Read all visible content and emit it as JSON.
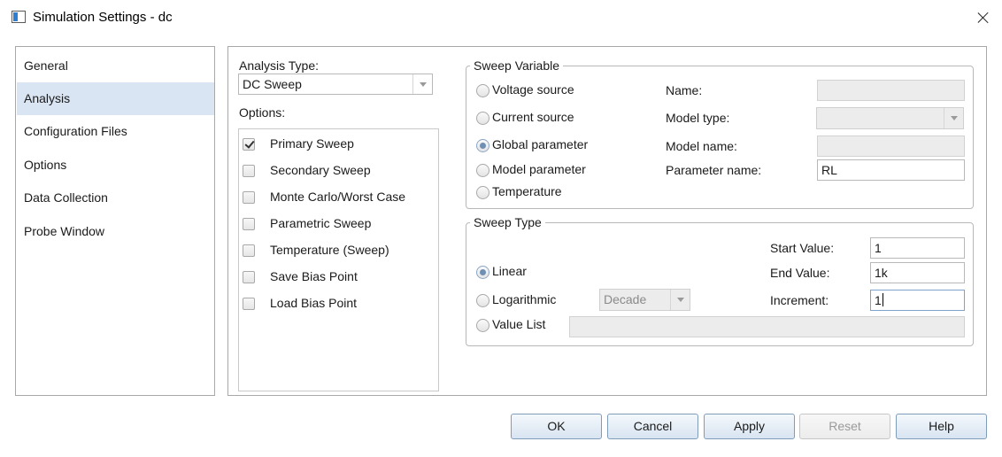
{
  "window": {
    "title": "Simulation Settings - dc"
  },
  "nav": {
    "items": [
      {
        "label": "General"
      },
      {
        "label": "Analysis"
      },
      {
        "label": "Configuration Files"
      },
      {
        "label": "Options"
      },
      {
        "label": "Data Collection"
      },
      {
        "label": "Probe Window"
      }
    ],
    "selected": "Analysis"
  },
  "analysis": {
    "type_label": "Analysis Type:",
    "type_value": "DC Sweep",
    "options_label": "Options:",
    "options": [
      {
        "label": "Primary Sweep",
        "checked": true
      },
      {
        "label": "Secondary Sweep",
        "checked": false
      },
      {
        "label": "Monte Carlo/Worst Case",
        "checked": false
      },
      {
        "label": "Parametric Sweep",
        "checked": false
      },
      {
        "label": "Temperature (Sweep)",
        "checked": false
      },
      {
        "label": "Save Bias Point",
        "checked": false
      },
      {
        "label": "Load Bias Point",
        "checked": false
      }
    ]
  },
  "sweep_variable": {
    "title": "Sweep Variable",
    "radios": [
      {
        "label": "Voltage source",
        "selected": false
      },
      {
        "label": "Current source",
        "selected": false
      },
      {
        "label": "Global parameter",
        "selected": true
      },
      {
        "label": "Model parameter",
        "selected": false
      },
      {
        "label": "Temperature",
        "selected": false
      }
    ],
    "name_label": "Name:",
    "name_value": "",
    "model_type_label": "Model type:",
    "model_type_value": "",
    "model_name_label": "Model name:",
    "model_name_value": "",
    "parameter_name_label": "Parameter name:",
    "parameter_name_value": "RL"
  },
  "sweep_type": {
    "title": "Sweep Type",
    "radios": [
      {
        "label": "Linear",
        "selected": true
      },
      {
        "label": "Logarithmic",
        "selected": false
      },
      {
        "label": "Value List",
        "selected": false
      }
    ],
    "log_scale_value": "Decade",
    "start_label": "Start Value:",
    "start_value": "1",
    "end_label": "End Value:",
    "end_value": "1k",
    "increment_label": "Increment:",
    "increment_value": "1",
    "value_list_value": ""
  },
  "buttons": {
    "ok": "OK",
    "cancel": "Cancel",
    "apply": "Apply",
    "reset": "Reset",
    "help": "Help"
  },
  "colors": {
    "selected_nav_bg": "#d9e5f3",
    "button_border": "#7f9db9",
    "radio_dot": "#6f8fb3"
  }
}
